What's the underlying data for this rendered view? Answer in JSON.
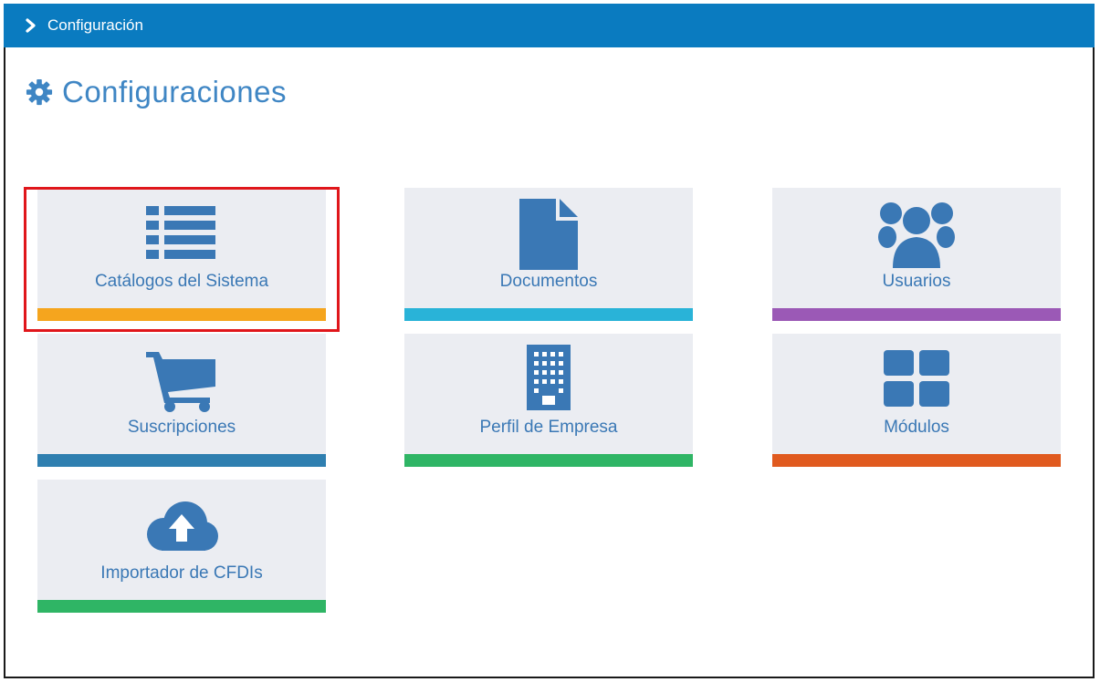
{
  "header": {
    "breadcrumb": "Configuración"
  },
  "page": {
    "title": "Configuraciones",
    "title_icon": "gear-icon"
  },
  "colors": {
    "topbar": "#0a7bc0",
    "tile_bg": "#ebedf2",
    "icon": "#3a78b5",
    "highlight": "#e0161b"
  },
  "tiles": [
    {
      "label": "Catálogos del Sistema",
      "icon": "list-icon",
      "bar_color": "#f5a51e",
      "highlighted": true
    },
    {
      "label": "Documentos",
      "icon": "document-icon",
      "bar_color": "#29b3d8"
    },
    {
      "label": "Usuarios",
      "icon": "users-icon",
      "bar_color": "#9b59b6"
    },
    {
      "label": "Suscripciones",
      "icon": "cart-icon",
      "bar_color": "#2f7fb0"
    },
    {
      "label": "Perfil de Empresa",
      "icon": "building-icon",
      "bar_color": "#2fb565"
    },
    {
      "label": "Módulos",
      "icon": "grid-icon",
      "bar_color": "#e05a1f"
    },
    {
      "label": "Importador de CFDIs",
      "icon": "cloud-upload-icon",
      "bar_color": "#2fb565"
    }
  ]
}
